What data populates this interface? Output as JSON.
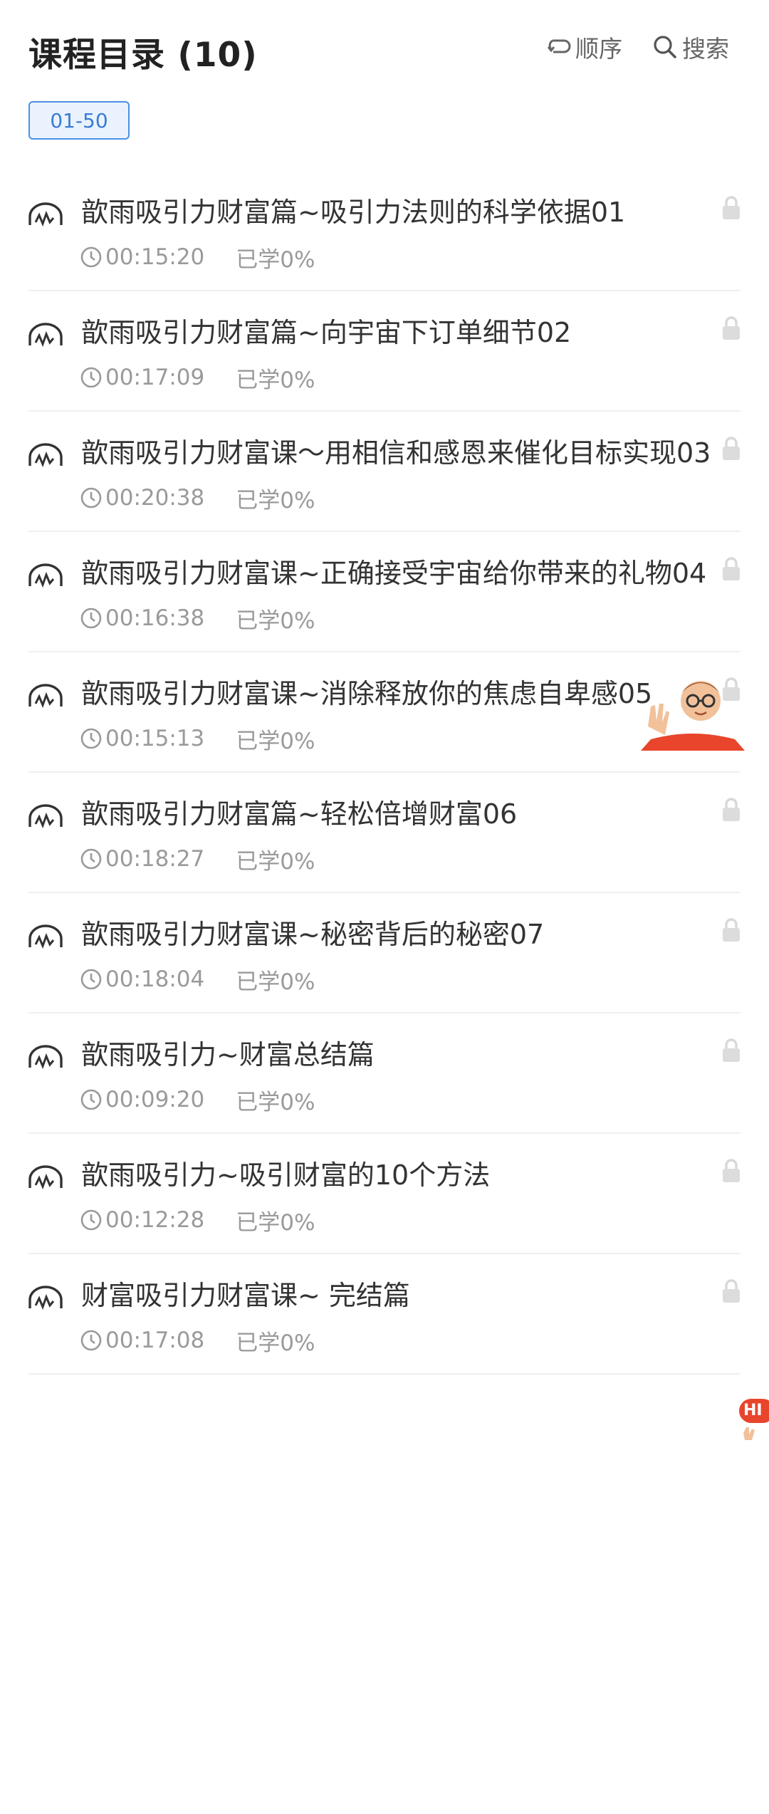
{
  "header": {
    "title": "课程目录 (10)",
    "order_label": "顺序",
    "search_label": "搜索"
  },
  "range_tab": {
    "label": "01-50"
  },
  "lessons": [
    {
      "title": "歆雨吸引力财富篇~吸引力法则的科学依据01",
      "duration": "00:15:20",
      "progress": "已学0%"
    },
    {
      "title": "歆雨吸引力财富篇~向宇宙下订单细节02",
      "duration": "00:17:09",
      "progress": "已学0%"
    },
    {
      "title": "歆雨吸引力财富课～用相信和感恩来催化目标实现03",
      "duration": "00:20:38",
      "progress": "已学0%"
    },
    {
      "title": "歆雨吸引力财富课~正确接受宇宙给你带来的礼物04",
      "duration": "00:16:38",
      "progress": "已学0%"
    },
    {
      "title": "歆雨吸引力财富课~消除释放你的焦虑自卑感05",
      "duration": "00:15:13",
      "progress": "已学0%"
    },
    {
      "title": "歆雨吸引力财富篇~轻松倍增财富06",
      "duration": "00:18:27",
      "progress": "已学0%"
    },
    {
      "title": "歆雨吸引力财富课~秘密背后的秘密07",
      "duration": "00:18:04",
      "progress": "已学0%"
    },
    {
      "title": "歆雨吸引力~财富总结篇",
      "duration": "00:09:20",
      "progress": "已学0%"
    },
    {
      "title": "歆雨吸引力~吸引财富的10个方法",
      "duration": "00:12:28",
      "progress": "已学0%"
    },
    {
      "title": "财富吸引力财富课~ 完结篇",
      "duration": "00:17:08",
      "progress": "已学0%"
    }
  ],
  "floating": {
    "hi_text": "HI"
  },
  "colors": {
    "accent": "#3a7bd5",
    "muted": "#9a9a9a",
    "divider": "#f0f0f0",
    "badge": "#e8452c"
  },
  "icons": {
    "item_leading": "headphones-icon",
    "item_trailing": "lock-icon",
    "meta": "clock-icon"
  }
}
